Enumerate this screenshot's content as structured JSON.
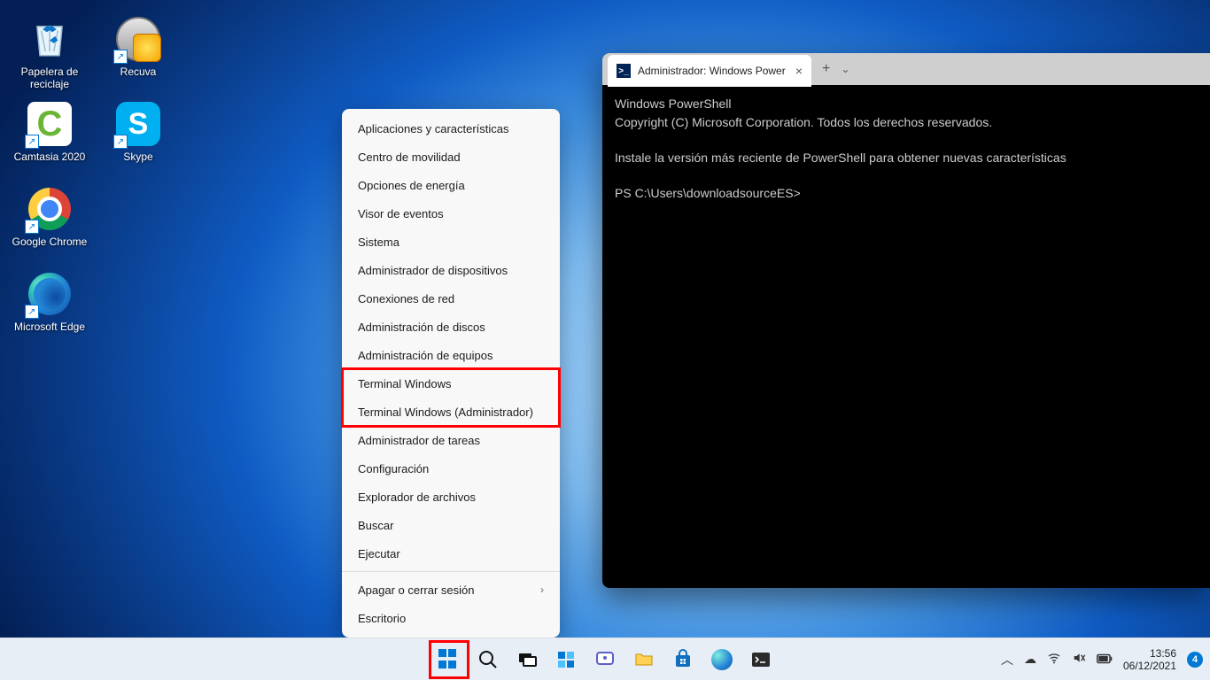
{
  "desktop": {
    "icons": [
      {
        "name": "recycle-bin",
        "label": "Papelera de\nreciclaje",
        "shortcut": false
      },
      {
        "name": "recuva",
        "label": "Recuva",
        "shortcut": true
      },
      {
        "name": "camtasia",
        "label": "Camtasia 2020",
        "shortcut": true
      },
      {
        "name": "skype",
        "label": "Skype",
        "shortcut": true
      },
      {
        "name": "chrome",
        "label": "Google Chrome",
        "shortcut": true
      },
      {
        "name": "spacer",
        "label": "",
        "shortcut": false
      },
      {
        "name": "edge",
        "label": "Microsoft Edge",
        "shortcut": true
      }
    ]
  },
  "winx_menu": {
    "items_top": [
      "Aplicaciones y características",
      "Centro de movilidad",
      "Opciones de energía",
      "Visor de eventos",
      "Sistema",
      "Administrador de dispositivos",
      "Conexiones de red",
      "Administración de discos",
      "Administración de equipos",
      "Terminal Windows",
      "Terminal Windows (Administrador)",
      "Administrador de tareas",
      "Configuración",
      "Explorador de archivos",
      "Buscar",
      "Ejecutar"
    ],
    "items_bottom": [
      {
        "label": "Apagar o cerrar sesión",
        "sub": true
      },
      {
        "label": "Escritorio",
        "sub": false
      }
    ]
  },
  "terminal": {
    "tab_title": "Administrador: Windows Power",
    "line1": "Windows PowerShell",
    "line2": "Copyright (C) Microsoft Corporation. Todos los derechos reservados.",
    "line3": "Instale la versión más reciente de PowerShell para obtener nuevas características",
    "prompt": "PS C:\\Users\\downloadsourceES>"
  },
  "taskbar": {
    "icons": [
      "start",
      "search",
      "taskview",
      "widgets",
      "chat",
      "explorer",
      "store",
      "edge",
      "terminal"
    ]
  },
  "tray": {
    "time": "13:56",
    "date": "06/12/2021",
    "notif_count": "4"
  }
}
